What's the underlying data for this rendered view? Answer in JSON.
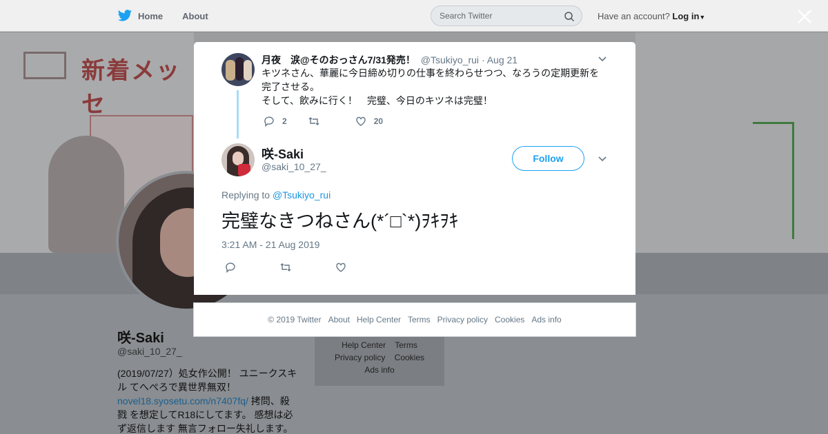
{
  "nav": {
    "home": "Home",
    "about": "About"
  },
  "search": {
    "placeholder": "Search Twitter"
  },
  "account": {
    "prompt": "Have an account?",
    "login": "Log in"
  },
  "banner": {
    "text": "新着メッセ"
  },
  "profile": {
    "name": "咲-Saki",
    "handle": "@saki_10_27_",
    "bio_1": "(2019/07/27）処女作公開！ ユニークスキル てへぺろで異世界無双！",
    "bio_link": "novel18.syosetu.com/n7407fq/",
    "bio_2": " 拷問、殺戮 を想定してR18にしてます。 感想は必ず返信します 無言フォロー失礼します。"
  },
  "bg_footer": {
    "help": "Help Center",
    "terms": "Terms",
    "privacy": "Privacy policy",
    "cookies": "Cookies",
    "ads": "Ads info"
  },
  "parent_tweet": {
    "name": "月夜　涙@そのおっさん7/31発売！",
    "handle": "@Tsukiyo_rui",
    "date": "· Aug 21",
    "line1": "キツネさん、華麗に今日締め切りの仕事を終わらせつつ、なろうの定期更新を完了させる。",
    "line2": "そして、飲みに行く！　完璧、今日のキツネは完璧！",
    "replies": "2",
    "retweets": "",
    "likes": "20"
  },
  "main_tweet": {
    "name": "咲-Saki",
    "handle": "@saki_10_27_",
    "follow": "Follow",
    "replying_label": "Replying to",
    "replying_to": "@Tsukiyo_rui",
    "text": "完璧なきつねさん(*´□`*)ｦｷｦｷ",
    "timestamp": "3:21 AM - 21 Aug 2019"
  },
  "footer": {
    "copyright": "© 2019 Twitter",
    "about": "About",
    "help": "Help Center",
    "terms": "Terms",
    "privacy": "Privacy policy",
    "cookies": "Cookies",
    "ads": "Ads info"
  },
  "colors": {
    "accent": "#1da1f2",
    "thread": "#a6dcf7",
    "muted": "#657786"
  }
}
